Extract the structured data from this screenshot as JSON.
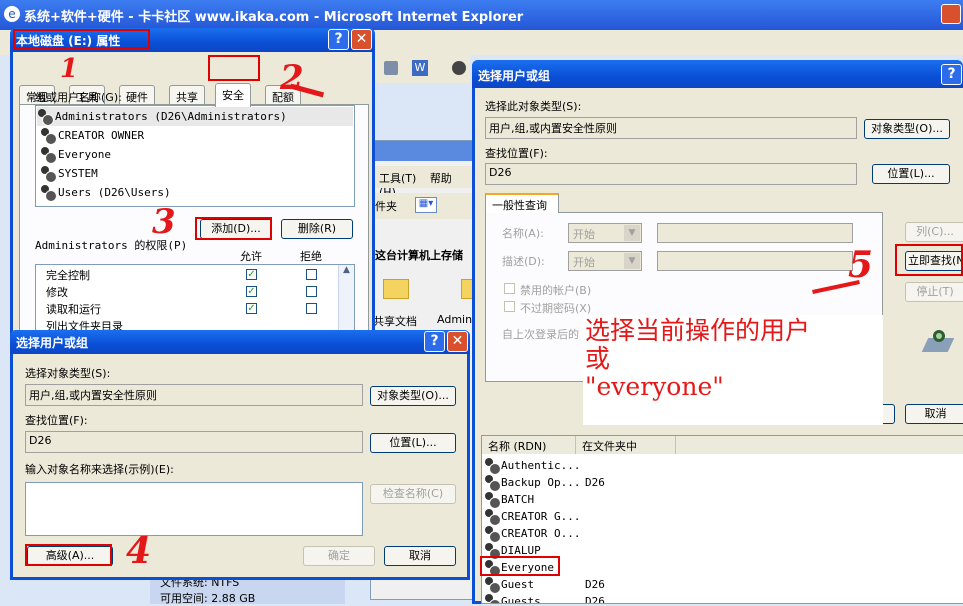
{
  "ie": {
    "title": "系统+软件+硬件 - 卡卡社区 www.ikaka.com - Microsoft Internet Explorer"
  },
  "bg": {
    "tools_menu": "工具(T)",
    "help_menu": "帮助(H)",
    "folder_text": "件夹",
    "pc_text": "这台计算机上存储",
    "shared_docs": "共享文档",
    "admin_folder": "Admini",
    "fs_label": "文件系统: NTFS",
    "free_space": "可用空间: 2.88 GB"
  },
  "props": {
    "title": "本地磁盘 (E:) 属性",
    "tabs": [
      "常规",
      "工具",
      "硬件",
      "共享",
      "安全",
      "配额"
    ],
    "group_label": "组或用户名称(G):",
    "users": [
      "Administrators (D26\\Administrators)",
      "CREATOR OWNER",
      "Everyone",
      "SYSTEM",
      "Users (D26\\Users)"
    ],
    "add_btn": "添加(D)...",
    "remove_btn": "删除(R)",
    "perm_label": "Administrators 的权限(P)",
    "allow": "允许",
    "deny": "拒绝",
    "permissions": [
      "完全控制",
      "修改",
      "读取和运行",
      "列出文件夹目录"
    ]
  },
  "dlg1": {
    "title": "选择用户或组",
    "obj_type_label": "选择对象类型(S):",
    "obj_type_value": "用户,组,或内置安全性原则",
    "obj_type_btn": "对象类型(O)...",
    "loc_label": "查找位置(F):",
    "loc_value": "D26",
    "loc_btn": "位置(L)...",
    "enter_label": "输入对象名称来选择(示例)(E):",
    "check_btn": "检查名称(C)",
    "advanced_btn": "高级(A)...",
    "ok_btn": "确定",
    "cancel_btn": "取消"
  },
  "dlg2": {
    "title": "选择用户或组",
    "obj_type_label": "选择此对象类型(S):",
    "obj_type_value": "用户,组,或内置安全性原则",
    "obj_type_btn": "对象类型(O)...",
    "loc_label": "查找位置(F):",
    "loc_value": "D26",
    "loc_btn": "位置(L)...",
    "query_tab": "一般性查询",
    "name_label": "名称(A):",
    "desc_label": "描述(D):",
    "start_option": "开始",
    "disabled_acct": "禁用的帐户(B)",
    "no_expire": "不过期密码(X)",
    "last_login": "自上次登录后的",
    "columns_btn": "列(C)...",
    "find_now_btn": "立即查找(N)",
    "stop_btn": "停止(T)",
    "cancel_btn": "取消",
    "col_name": "名称 (RDN)",
    "col_folder": "在文件夹中",
    "results": [
      {
        "name": "Authentic...",
        "folder": ""
      },
      {
        "name": "Backup Op...",
        "folder": "D26"
      },
      {
        "name": "BATCH",
        "folder": ""
      },
      {
        "name": "CREATOR G...",
        "folder": ""
      },
      {
        "name": "CREATOR O...",
        "folder": ""
      },
      {
        "name": "DIALUP",
        "folder": ""
      },
      {
        "name": "Everyone",
        "folder": ""
      },
      {
        "name": "Guest",
        "folder": "D26"
      },
      {
        "name": "Guests",
        "folder": "D26"
      }
    ]
  },
  "annotation": {
    "line1": "选择当前操作的用户",
    "line2": "或",
    "line3": "\"everyone\"",
    "steps": [
      "1",
      "2",
      "3",
      "4",
      "5"
    ]
  }
}
